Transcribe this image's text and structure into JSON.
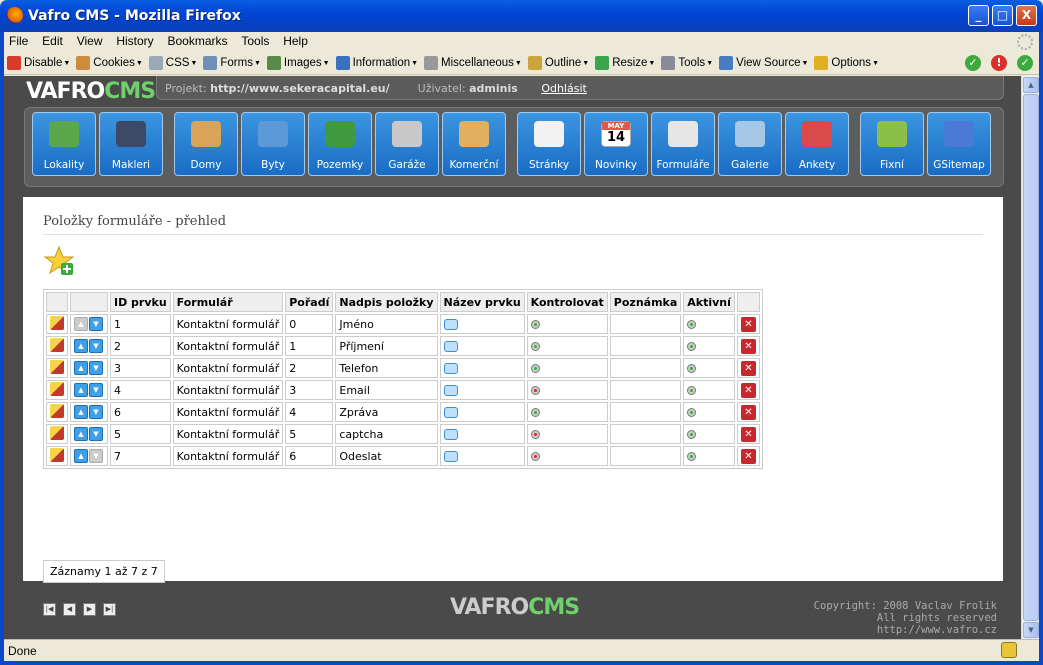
{
  "window": {
    "title": "Vafro CMS - Mozilla Firefox",
    "min_glyph": "_",
    "max_glyph": "□",
    "close_glyph": "X"
  },
  "menubar": [
    "File",
    "Edit",
    "View",
    "History",
    "Bookmarks",
    "Tools",
    "Help"
  ],
  "toolbar": [
    {
      "label": "Disable",
      "icon": "disable-icon",
      "color": "#d93b2b"
    },
    {
      "label": "Cookies",
      "icon": "cookies-icon",
      "color": "#d08a3b"
    },
    {
      "label": "CSS",
      "icon": "css-icon",
      "color": "#9aa8b8"
    },
    {
      "label": "Forms",
      "icon": "forms-icon",
      "color": "#6f8fb8"
    },
    {
      "label": "Images",
      "icon": "images-icon",
      "color": "#5a8a4a"
    },
    {
      "label": "Information",
      "icon": "information-icon",
      "color": "#3a70c0"
    },
    {
      "label": "Miscellaneous",
      "icon": "miscellaneous-icon",
      "color": "#999999"
    },
    {
      "label": "Outline",
      "icon": "outline-icon",
      "color": "#c9a53a"
    },
    {
      "label": "Resize",
      "icon": "resize-icon",
      "color": "#3aa54a"
    },
    {
      "label": "Tools",
      "icon": "tools-icon",
      "color": "#8a8a9a"
    },
    {
      "label": "View Source",
      "icon": "view-source-icon",
      "color": "#4a7ac0"
    },
    {
      "label": "Options",
      "icon": "options-icon",
      "color": "#e0b020"
    }
  ],
  "cms": {
    "logo_main": "VAFRO",
    "logo_cms": "CMS",
    "project_label": "Projekt:",
    "project_value": "http://www.sekeracapital.eu/",
    "user_label": "Uživatel:",
    "user_value": "adminis",
    "logout": "Odhlásit"
  },
  "modules": [
    {
      "label": "Lokality",
      "icon": "globe-icon",
      "color": "#5aa84a"
    },
    {
      "label": "Makleri",
      "icon": "people-icon",
      "color": "#3d4a66"
    },
    {
      "label": "Domy",
      "icon": "house-icon",
      "color": "#d9a35a"
    },
    {
      "label": "Byty",
      "icon": "apartments-icon",
      "color": "#5b9ad6"
    },
    {
      "label": "Pozemky",
      "icon": "tree-icon",
      "color": "#3f9a3f"
    },
    {
      "label": "Garáže",
      "icon": "car-icon",
      "color": "#c8c8c8"
    },
    {
      "label": "Komerční",
      "icon": "bank-icon",
      "color": "#e0b060"
    },
    {
      "label": "Stránky",
      "icon": "page-icon",
      "color": "#f2f2f2"
    },
    {
      "label": "Novinky",
      "icon": "calendar-icon",
      "color": "#e05a4a"
    },
    {
      "label": "Formuláře",
      "icon": "form-icon",
      "color": "#e6e6e6"
    },
    {
      "label": "Galerie",
      "icon": "gallery-icon",
      "color": "#a6c8e6"
    },
    {
      "label": "Ankety",
      "icon": "poll-icon",
      "color": "#d94a4a"
    },
    {
      "label": "Fixní",
      "icon": "fixed-icon",
      "color": "#8ac04a"
    },
    {
      "label": "GSitemap",
      "icon": "sitemap-icon",
      "color": "#4a7ad6"
    }
  ],
  "calendar_month": "MAY",
  "calendar_day": "14",
  "page": {
    "title": "Položky formuláře - přehled",
    "columns": [
      "ID prvku",
      "Formulář",
      "Pořadí",
      "Nadpis položky",
      "Název prvku",
      "Kontrolovat",
      "Poznámka",
      "Aktivní"
    ],
    "rows": [
      {
        "id": "1",
        "form": "Kontaktní formulář",
        "order": "0",
        "heading": "Jméno",
        "check": "on",
        "active": "on"
      },
      {
        "id": "2",
        "form": "Kontaktní formulář",
        "order": "1",
        "heading": "Příjmení",
        "check": "on",
        "active": "on"
      },
      {
        "id": "3",
        "form": "Kontaktní formulář",
        "order": "2",
        "heading": "Telefon",
        "check": "on",
        "active": "on"
      },
      {
        "id": "4",
        "form": "Kontaktní formulář",
        "order": "3",
        "heading": "Email",
        "check": "off",
        "active": "on"
      },
      {
        "id": "6",
        "form": "Kontaktní formulář",
        "order": "4",
        "heading": "Zpráva",
        "check": "on",
        "active": "on"
      },
      {
        "id": "5",
        "form": "Kontaktní formulář",
        "order": "5",
        "heading": "captcha",
        "check": "off",
        "active": "on"
      },
      {
        "id": "7",
        "form": "Kontaktní formulář",
        "order": "6",
        "heading": "Odeslat",
        "check": "off",
        "active": "on"
      }
    ],
    "records": "Záznamy 1 až 7 z 7"
  },
  "footer": {
    "copyright": "Copyright: 2008 Vaclav Frolik",
    "rights": "All rights reserved",
    "url": "http://www.vafro.cz"
  },
  "status": "Done"
}
